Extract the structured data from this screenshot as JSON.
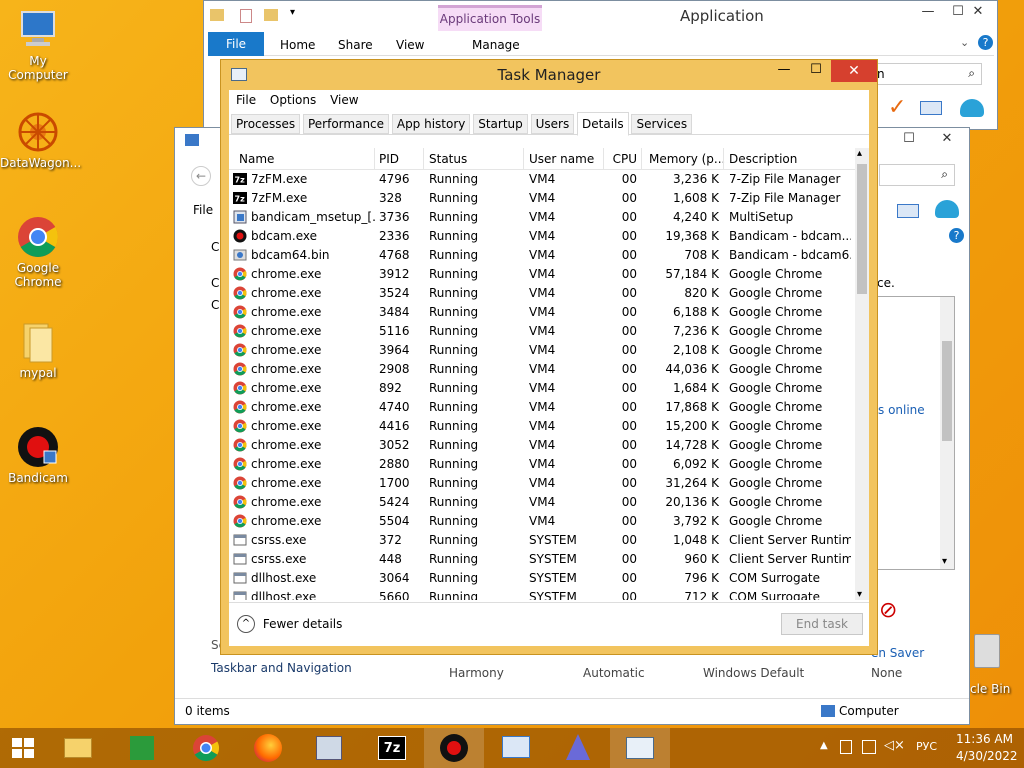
{
  "desktop": {
    "icons": [
      {
        "label": "My Computer"
      },
      {
        "label": "DataWagon..."
      },
      {
        "label": "Google Chrome"
      },
      {
        "label": "mypal"
      },
      {
        "label": "Bandicam"
      }
    ],
    "recycle_label": "cle Bin"
  },
  "explorer": {
    "title": "Application",
    "ribbon_tabs": [
      "File",
      "Home",
      "Share",
      "View"
    ],
    "contextual_group": "Application Tools",
    "contextual_tab": "Manage",
    "search_hint": "n"
  },
  "control_panel": {
    "file_label": "File",
    "truncated": [
      "C",
      "C",
      "C"
    ],
    "sidebar_frag": "Se",
    "right_frag_1": "ce.",
    "right_frag_2": "s online",
    "bottom_link": "Taskbar and Navigation",
    "themes": [
      "Harmony",
      "Automatic",
      "Windows Default",
      "None"
    ],
    "saver_label": "en Saver",
    "status_items": "0 items",
    "status_location": "Computer"
  },
  "task_manager": {
    "title": "Task Manager",
    "menu": [
      "File",
      "Options",
      "View"
    ],
    "tabs": [
      "Processes",
      "Performance",
      "App history",
      "Startup",
      "Users",
      "Details",
      "Services"
    ],
    "active_tab": "Details",
    "columns": [
      "Name",
      "PID",
      "Status",
      "User name",
      "CPU",
      "Memory (p...",
      "Description"
    ],
    "rows": [
      {
        "icon": "7zip",
        "name": "7zFM.exe",
        "pid": "4796",
        "status": "Running",
        "user": "VM4",
        "cpu": "00",
        "mem": "3,236 K",
        "desc": "7-Zip File Manager"
      },
      {
        "icon": "7zip",
        "name": "7zFM.exe",
        "pid": "328",
        "status": "Running",
        "user": "VM4",
        "cpu": "00",
        "mem": "1,608 K",
        "desc": "7-Zip File Manager"
      },
      {
        "icon": "setup",
        "name": "bandicam_msetup_[...",
        "pid": "3736",
        "status": "Running",
        "user": "VM4",
        "cpu": "00",
        "mem": "4,240 K",
        "desc": "MultiSetup"
      },
      {
        "icon": "bandicam",
        "name": "bdcam.exe",
        "pid": "2336",
        "status": "Running",
        "user": "VM4",
        "cpu": "00",
        "mem": "19,368 K",
        "desc": "Bandicam - bdcam...."
      },
      {
        "icon": "bdcam64",
        "name": "bdcam64.bin",
        "pid": "4768",
        "status": "Running",
        "user": "VM4",
        "cpu": "00",
        "mem": "708 K",
        "desc": "Bandicam - bdcam6..."
      },
      {
        "icon": "chrome",
        "name": "chrome.exe",
        "pid": "3912",
        "status": "Running",
        "user": "VM4",
        "cpu": "00",
        "mem": "57,184 K",
        "desc": "Google Chrome"
      },
      {
        "icon": "chrome",
        "name": "chrome.exe",
        "pid": "3524",
        "status": "Running",
        "user": "VM4",
        "cpu": "00",
        "mem": "820 K",
        "desc": "Google Chrome"
      },
      {
        "icon": "chrome",
        "name": "chrome.exe",
        "pid": "3484",
        "status": "Running",
        "user": "VM4",
        "cpu": "00",
        "mem": "6,188 K",
        "desc": "Google Chrome"
      },
      {
        "icon": "chrome",
        "name": "chrome.exe",
        "pid": "5116",
        "status": "Running",
        "user": "VM4",
        "cpu": "00",
        "mem": "7,236 K",
        "desc": "Google Chrome"
      },
      {
        "icon": "chrome",
        "name": "chrome.exe",
        "pid": "3964",
        "status": "Running",
        "user": "VM4",
        "cpu": "00",
        "mem": "2,108 K",
        "desc": "Google Chrome"
      },
      {
        "icon": "chrome",
        "name": "chrome.exe",
        "pid": "2908",
        "status": "Running",
        "user": "VM4",
        "cpu": "00",
        "mem": "44,036 K",
        "desc": "Google Chrome"
      },
      {
        "icon": "chrome",
        "name": "chrome.exe",
        "pid": "892",
        "status": "Running",
        "user": "VM4",
        "cpu": "00",
        "mem": "1,684 K",
        "desc": "Google Chrome"
      },
      {
        "icon": "chrome",
        "name": "chrome.exe",
        "pid": "4740",
        "status": "Running",
        "user": "VM4",
        "cpu": "00",
        "mem": "17,868 K",
        "desc": "Google Chrome"
      },
      {
        "icon": "chrome",
        "name": "chrome.exe",
        "pid": "4416",
        "status": "Running",
        "user": "VM4",
        "cpu": "00",
        "mem": "15,200 K",
        "desc": "Google Chrome"
      },
      {
        "icon": "chrome",
        "name": "chrome.exe",
        "pid": "3052",
        "status": "Running",
        "user": "VM4",
        "cpu": "00",
        "mem": "14,728 K",
        "desc": "Google Chrome"
      },
      {
        "icon": "chrome",
        "name": "chrome.exe",
        "pid": "2880",
        "status": "Running",
        "user": "VM4",
        "cpu": "00",
        "mem": "6,092 K",
        "desc": "Google Chrome"
      },
      {
        "icon": "chrome",
        "name": "chrome.exe",
        "pid": "1700",
        "status": "Running",
        "user": "VM4",
        "cpu": "00",
        "mem": "31,264 K",
        "desc": "Google Chrome"
      },
      {
        "icon": "chrome",
        "name": "chrome.exe",
        "pid": "5424",
        "status": "Running",
        "user": "VM4",
        "cpu": "00",
        "mem": "20,136 K",
        "desc": "Google Chrome"
      },
      {
        "icon": "chrome",
        "name": "chrome.exe",
        "pid": "5504",
        "status": "Running",
        "user": "VM4",
        "cpu": "00",
        "mem": "3,792 K",
        "desc": "Google Chrome"
      },
      {
        "icon": "system",
        "name": "csrss.exe",
        "pid": "372",
        "status": "Running",
        "user": "SYSTEM",
        "cpu": "00",
        "mem": "1,048 K",
        "desc": "Client Server Runtim..."
      },
      {
        "icon": "system",
        "name": "csrss.exe",
        "pid": "448",
        "status": "Running",
        "user": "SYSTEM",
        "cpu": "00",
        "mem": "960 K",
        "desc": "Client Server Runtim..."
      },
      {
        "icon": "system",
        "name": "dllhost.exe",
        "pid": "3064",
        "status": "Running",
        "user": "SYSTEM",
        "cpu": "00",
        "mem": "796 K",
        "desc": "COM Surrogate"
      },
      {
        "icon": "system",
        "name": "dllhost.exe",
        "pid": "5660",
        "status": "Running",
        "user": "SYSTEM",
        "cpu": "00",
        "mem": "712 K",
        "desc": "COM Surrogate"
      }
    ],
    "fewer_details": "Fewer details",
    "end_task": "End task"
  },
  "tray": {
    "lang": "РУС",
    "time": "11:36 AM",
    "date": "4/30/2022"
  },
  "colors": {
    "ribbon_blue": "#1979ca",
    "tm_frame": "#f2c45e",
    "close_red": "#d6402e"
  }
}
